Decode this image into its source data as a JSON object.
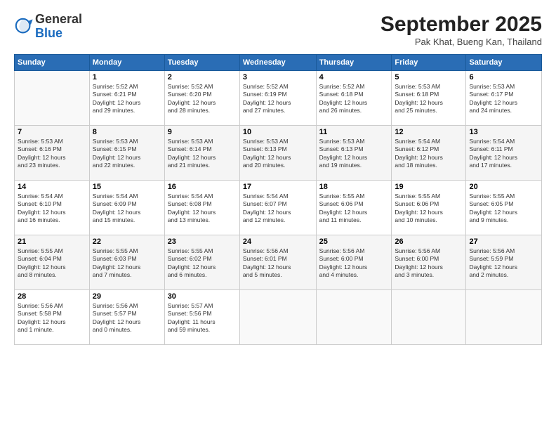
{
  "header": {
    "logo_general": "General",
    "logo_blue": "Blue",
    "month_title": "September 2025",
    "location": "Pak Khat, Bueng Kan, Thailand"
  },
  "columns": [
    "Sunday",
    "Monday",
    "Tuesday",
    "Wednesday",
    "Thursday",
    "Friday",
    "Saturday"
  ],
  "weeks": [
    [
      {
        "day": "",
        "info": ""
      },
      {
        "day": "1",
        "info": "Sunrise: 5:52 AM\nSunset: 6:21 PM\nDaylight: 12 hours\nand 29 minutes."
      },
      {
        "day": "2",
        "info": "Sunrise: 5:52 AM\nSunset: 6:20 PM\nDaylight: 12 hours\nand 28 minutes."
      },
      {
        "day": "3",
        "info": "Sunrise: 5:52 AM\nSunset: 6:19 PM\nDaylight: 12 hours\nand 27 minutes."
      },
      {
        "day": "4",
        "info": "Sunrise: 5:52 AM\nSunset: 6:18 PM\nDaylight: 12 hours\nand 26 minutes."
      },
      {
        "day": "5",
        "info": "Sunrise: 5:53 AM\nSunset: 6:18 PM\nDaylight: 12 hours\nand 25 minutes."
      },
      {
        "day": "6",
        "info": "Sunrise: 5:53 AM\nSunset: 6:17 PM\nDaylight: 12 hours\nand 24 minutes."
      }
    ],
    [
      {
        "day": "7",
        "info": "Sunrise: 5:53 AM\nSunset: 6:16 PM\nDaylight: 12 hours\nand 23 minutes."
      },
      {
        "day": "8",
        "info": "Sunrise: 5:53 AM\nSunset: 6:15 PM\nDaylight: 12 hours\nand 22 minutes."
      },
      {
        "day": "9",
        "info": "Sunrise: 5:53 AM\nSunset: 6:14 PM\nDaylight: 12 hours\nand 21 minutes."
      },
      {
        "day": "10",
        "info": "Sunrise: 5:53 AM\nSunset: 6:13 PM\nDaylight: 12 hours\nand 20 minutes."
      },
      {
        "day": "11",
        "info": "Sunrise: 5:53 AM\nSunset: 6:13 PM\nDaylight: 12 hours\nand 19 minutes."
      },
      {
        "day": "12",
        "info": "Sunrise: 5:54 AM\nSunset: 6:12 PM\nDaylight: 12 hours\nand 18 minutes."
      },
      {
        "day": "13",
        "info": "Sunrise: 5:54 AM\nSunset: 6:11 PM\nDaylight: 12 hours\nand 17 minutes."
      }
    ],
    [
      {
        "day": "14",
        "info": "Sunrise: 5:54 AM\nSunset: 6:10 PM\nDaylight: 12 hours\nand 16 minutes."
      },
      {
        "day": "15",
        "info": "Sunrise: 5:54 AM\nSunset: 6:09 PM\nDaylight: 12 hours\nand 15 minutes."
      },
      {
        "day": "16",
        "info": "Sunrise: 5:54 AM\nSunset: 6:08 PM\nDaylight: 12 hours\nand 13 minutes."
      },
      {
        "day": "17",
        "info": "Sunrise: 5:54 AM\nSunset: 6:07 PM\nDaylight: 12 hours\nand 12 minutes."
      },
      {
        "day": "18",
        "info": "Sunrise: 5:55 AM\nSunset: 6:06 PM\nDaylight: 12 hours\nand 11 minutes."
      },
      {
        "day": "19",
        "info": "Sunrise: 5:55 AM\nSunset: 6:06 PM\nDaylight: 12 hours\nand 10 minutes."
      },
      {
        "day": "20",
        "info": "Sunrise: 5:55 AM\nSunset: 6:05 PM\nDaylight: 12 hours\nand 9 minutes."
      }
    ],
    [
      {
        "day": "21",
        "info": "Sunrise: 5:55 AM\nSunset: 6:04 PM\nDaylight: 12 hours\nand 8 minutes."
      },
      {
        "day": "22",
        "info": "Sunrise: 5:55 AM\nSunset: 6:03 PM\nDaylight: 12 hours\nand 7 minutes."
      },
      {
        "day": "23",
        "info": "Sunrise: 5:55 AM\nSunset: 6:02 PM\nDaylight: 12 hours\nand 6 minutes."
      },
      {
        "day": "24",
        "info": "Sunrise: 5:56 AM\nSunset: 6:01 PM\nDaylight: 12 hours\nand 5 minutes."
      },
      {
        "day": "25",
        "info": "Sunrise: 5:56 AM\nSunset: 6:00 PM\nDaylight: 12 hours\nand 4 minutes."
      },
      {
        "day": "26",
        "info": "Sunrise: 5:56 AM\nSunset: 6:00 PM\nDaylight: 12 hours\nand 3 minutes."
      },
      {
        "day": "27",
        "info": "Sunrise: 5:56 AM\nSunset: 5:59 PM\nDaylight: 12 hours\nand 2 minutes."
      }
    ],
    [
      {
        "day": "28",
        "info": "Sunrise: 5:56 AM\nSunset: 5:58 PM\nDaylight: 12 hours\nand 1 minute."
      },
      {
        "day": "29",
        "info": "Sunrise: 5:56 AM\nSunset: 5:57 PM\nDaylight: 12 hours\nand 0 minutes."
      },
      {
        "day": "30",
        "info": "Sunrise: 5:57 AM\nSunset: 5:56 PM\nDaylight: 11 hours\nand 59 minutes."
      },
      {
        "day": "",
        "info": ""
      },
      {
        "day": "",
        "info": ""
      },
      {
        "day": "",
        "info": ""
      },
      {
        "day": "",
        "info": ""
      }
    ]
  ]
}
